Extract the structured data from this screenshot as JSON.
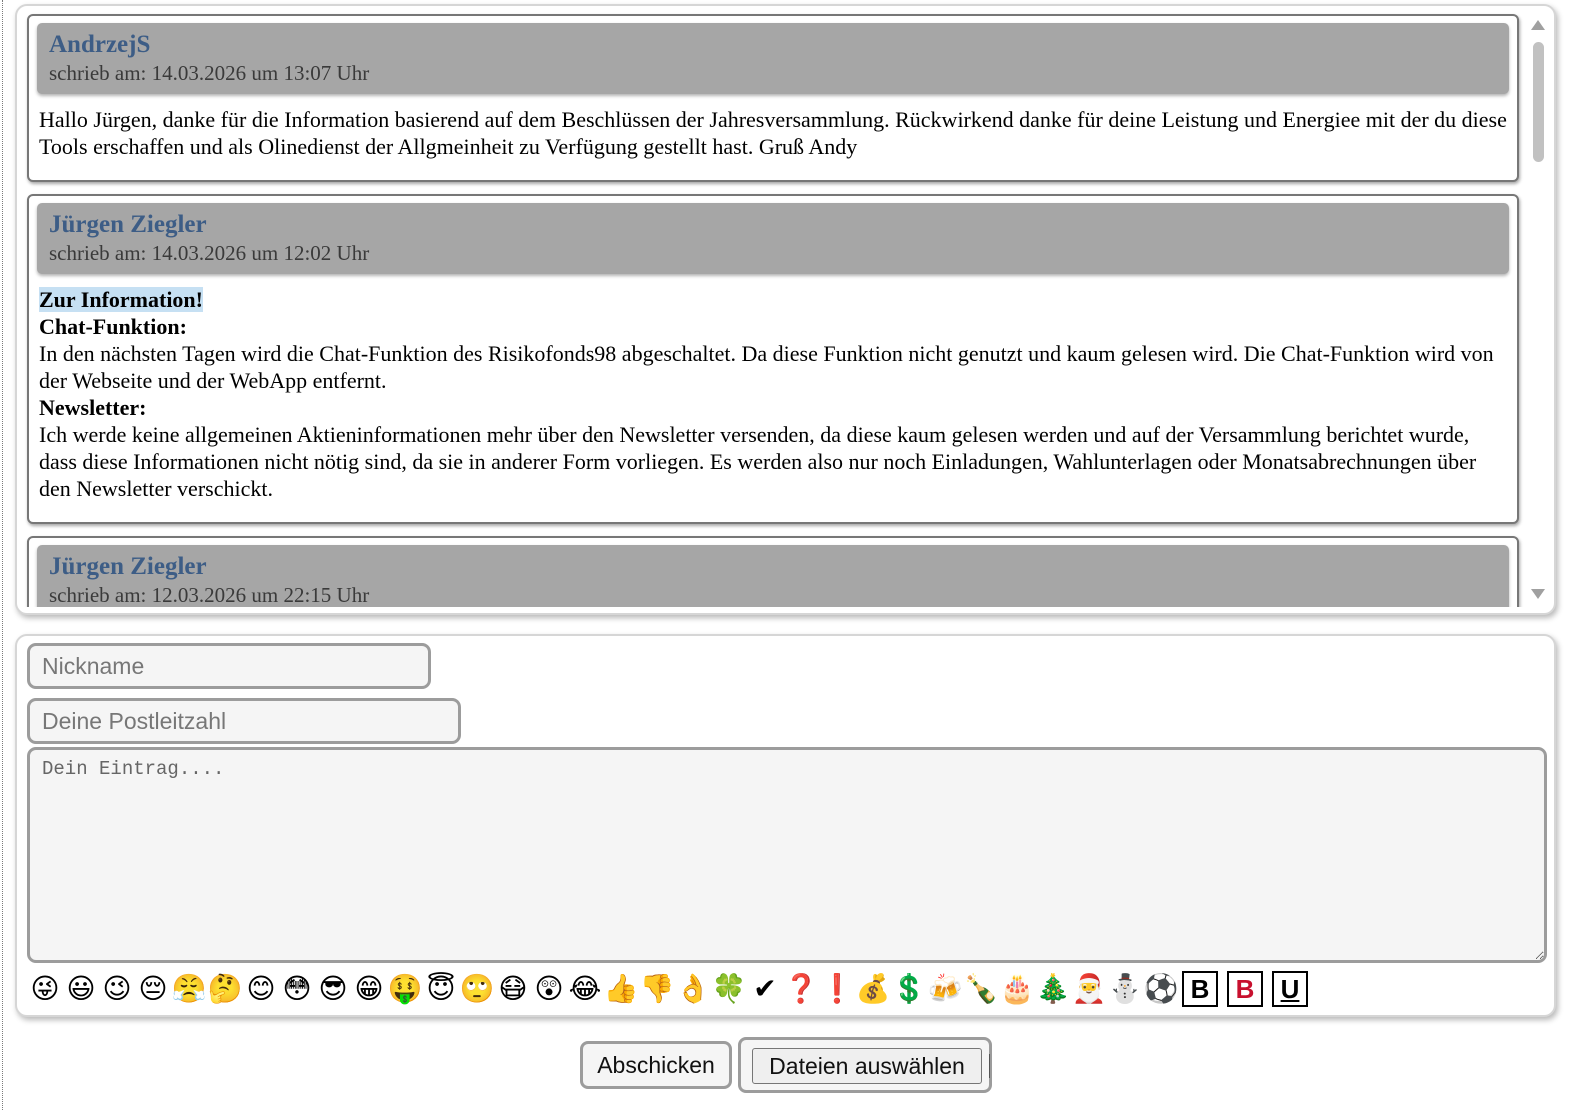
{
  "entries": [
    {
      "author": "AndrzejS",
      "date": "schrieb am: 14.03.2026 um 13:07 Uhr",
      "text": "Hallo Jürgen, danke für die Information basierend auf dem Beschlüssen der Jahresversammlung. Rückwirkend danke für deine Leistung und Energiee mit der du diese Tools erschaffen und als Olinedienst der Allgmeinheit zu Verfügung gestellt hast. Gruß Andy"
    },
    {
      "author": "Jürgen Ziegler",
      "date": "schrieb am: 14.03.2026 um 12:02 Uhr",
      "heading": "Zur Information!",
      "section1_title": "Chat-Funktion:",
      "section1_text": "In den nächsten Tagen wird die Chat-Funktion des Risikofonds98 abgeschaltet. Da diese Funktion nicht genutzt und kaum gelesen wird. Die Chat-Funktion wird von der Webseite und der WebApp entfernt.",
      "section2_title": "Newsletter:",
      "section2_text": "Ich werde keine allgemeinen Aktieninformationen mehr über den Newsletter versenden, da diese kaum gelesen werden und auf der Versammlung berichtet wurde, dass diese Informationen nicht nötig sind, da sie in anderer Form vorliegen. Es werden also nur noch Einladungen, Wahlunterlagen oder Monatsabrechnungen über den Newsletter verschickt."
    },
    {
      "author": "Jürgen Ziegler",
      "date": "schrieb am: 12.03.2026 um 22:15 Uhr"
    }
  ],
  "form": {
    "nickname_placeholder": "Nickname",
    "nickname_value": "",
    "postcode_placeholder": "Deine Postleitzahl",
    "postcode_value": "",
    "entry_placeholder": "Dein Eintrag....",
    "entry_value": ""
  },
  "emojis": [
    "😜",
    "😃",
    "😉",
    "😔",
    "😤",
    "🤔",
    "😊",
    "😳",
    "😎",
    "😁",
    "🤑",
    "😇",
    "🙄",
    "😷",
    "😲",
    "😂",
    "👍",
    "👎",
    "👌",
    "🍀",
    "✔",
    "❓",
    "❗",
    "💰",
    "💲",
    "🍻",
    "🍾",
    "🎂",
    "🎄",
    "🎅",
    "⛄",
    "⚽"
  ],
  "format_buttons": {
    "bold": "B",
    "bold_red": "B",
    "underline": "U"
  },
  "buttons": {
    "submit": "Abschicken",
    "choose_files": "Dateien auswählen"
  },
  "colors": {
    "author": "#3d5d86",
    "header_bg": "#a6a6a6",
    "highlight": "#c6e0f3",
    "red_bold": "#c8102e"
  }
}
